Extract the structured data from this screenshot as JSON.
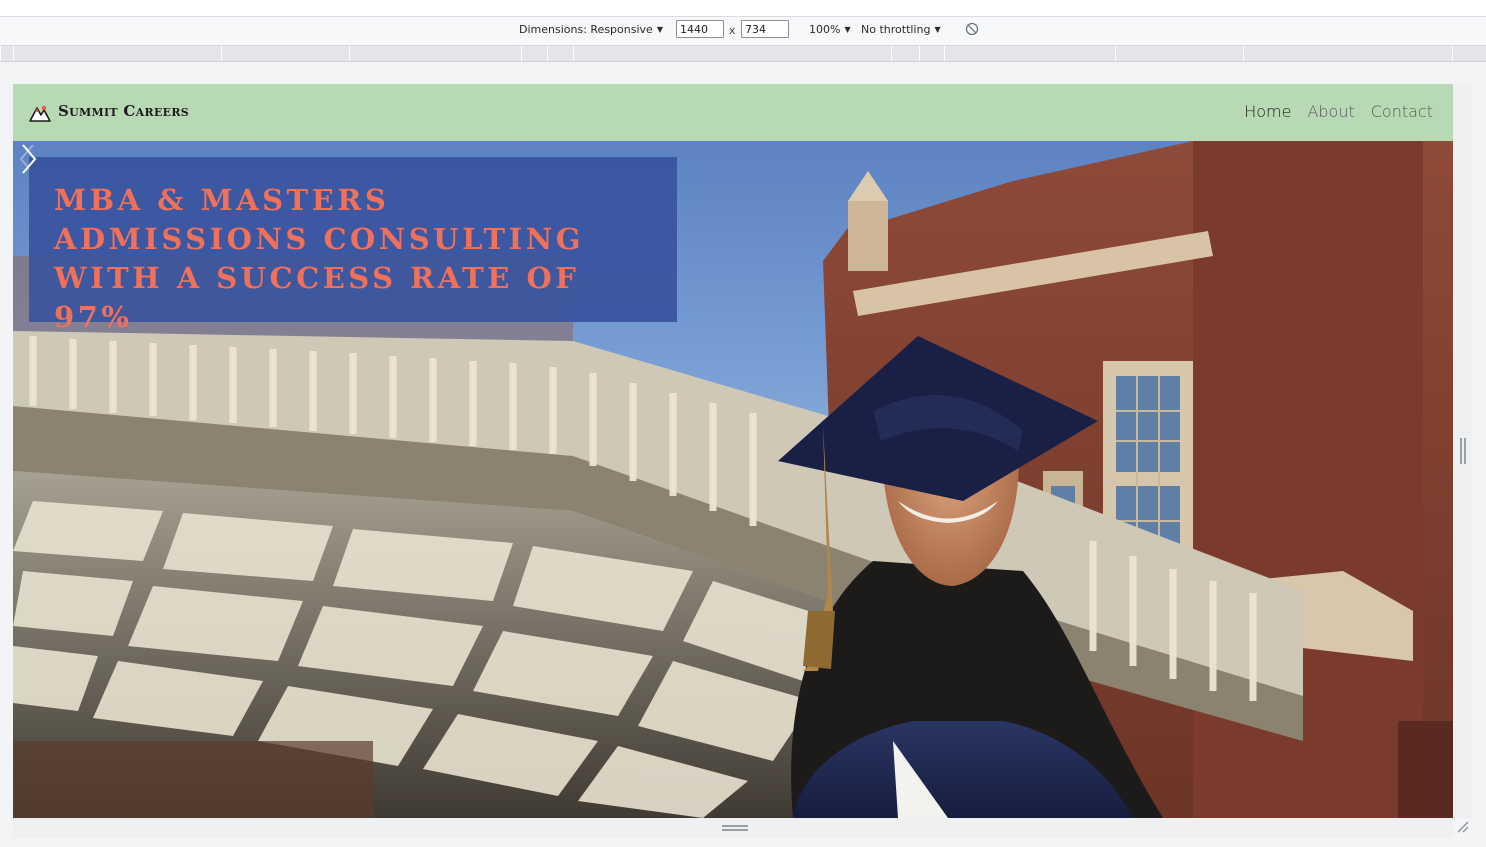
{
  "devtools": {
    "dimensions_label": "Dimensions: Responsive",
    "width_value": "1440",
    "height_value": "734",
    "times": "x",
    "zoom_label": "100%",
    "throttling_label": "No throttling"
  },
  "site": {
    "brand": "Summit Careers",
    "nav": [
      {
        "label": "Home"
      },
      {
        "label": "About"
      },
      {
        "label": "Contact"
      }
    ],
    "hero_caption": "MBA & Masters Admissions Consulting with a Success Rate of 97%"
  },
  "colors": {
    "navbar": "#b7d9b3",
    "caption_bg": "#38549e",
    "caption_text": "#f0705a"
  },
  "icons": [
    "mountain-logo-icon",
    "rotate-icon",
    "chevron-right-icon",
    "chevron-left-icon",
    "resize-grip-icon"
  ]
}
